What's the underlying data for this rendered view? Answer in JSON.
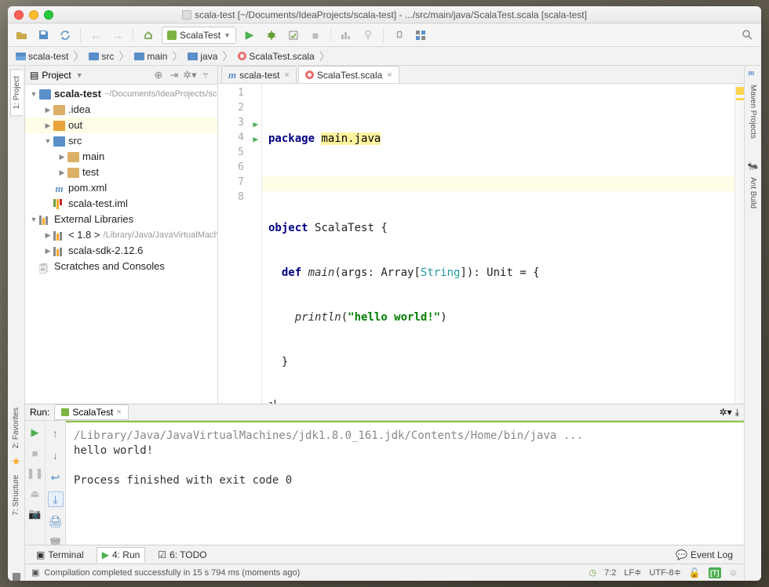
{
  "window_title": "scala-test [~/Documents/IdeaProjects/scala-test] - .../src/main/java/ScalaTest.scala [scala-test]",
  "toolbar": {
    "run_config": "ScalaTest"
  },
  "breadcrumb": [
    "scala-test",
    "src",
    "main",
    "java",
    "ScalaTest.scala"
  ],
  "left_gutter": {
    "project_tab": "1: Project"
  },
  "right_gutter": {
    "maven": "Maven Projects",
    "ant": "Ant Build"
  },
  "project_panel": {
    "title": "Project",
    "tree": {
      "root": "scala-test",
      "root_path": "~/Documents/IdeaProjects/scala-test",
      "idea": ".idea",
      "out": "out",
      "src": "src",
      "main": "main",
      "test": "test",
      "pom": "pom.xml",
      "iml": "scala-test.iml",
      "ext": "External Libraries",
      "jdk": "< 1.8 >",
      "jdk_path": "/Library/Java/JavaVirtualMachines",
      "sdk": "scala-sdk-2.12.6",
      "scratch": "Scratches and Consoles"
    }
  },
  "editor_tabs": [
    {
      "label": "scala-test",
      "type": "m"
    },
    {
      "label": "ScalaTest.scala",
      "type": "scala",
      "active": true
    }
  ],
  "code": {
    "l1": {
      "kw": "package",
      "pkg": "main.java"
    },
    "l3": {
      "kw": "object",
      "name": "ScalaTest",
      "brace": "{"
    },
    "l4": {
      "kw": "def",
      "fn": "main",
      "sig1": "(args: Array[",
      "type": "String",
      "sig2": "]): Unit = {"
    },
    "l5": {
      "fn": "println",
      "open": "(",
      "str": "\"hello world!\"",
      "close": ")"
    },
    "l6": "  }",
    "l7": "}"
  },
  "run_panel": {
    "label": "Run:",
    "tab": "ScalaTest",
    "console": {
      "java_path": "/Library/Java/JavaVirtualMachines/jdk1.8.0_161.jdk/Contents/Home/bin/java ...",
      "out1": "hello world!",
      "exit": "Process finished with exit code 0"
    }
  },
  "left_side_tabs": {
    "favorites": "2: Favorites",
    "structure": "7: Structure"
  },
  "bottom_tabs": {
    "terminal": "Terminal",
    "run": "4: Run",
    "todo": "6: TODO",
    "event_log": "Event Log"
  },
  "status": {
    "msg": "Compilation completed successfully in 15 s 794 ms (moments ago)",
    "pos": "7:2",
    "lf": "LF",
    "enc": "UTF-8",
    "t": "[T]"
  }
}
